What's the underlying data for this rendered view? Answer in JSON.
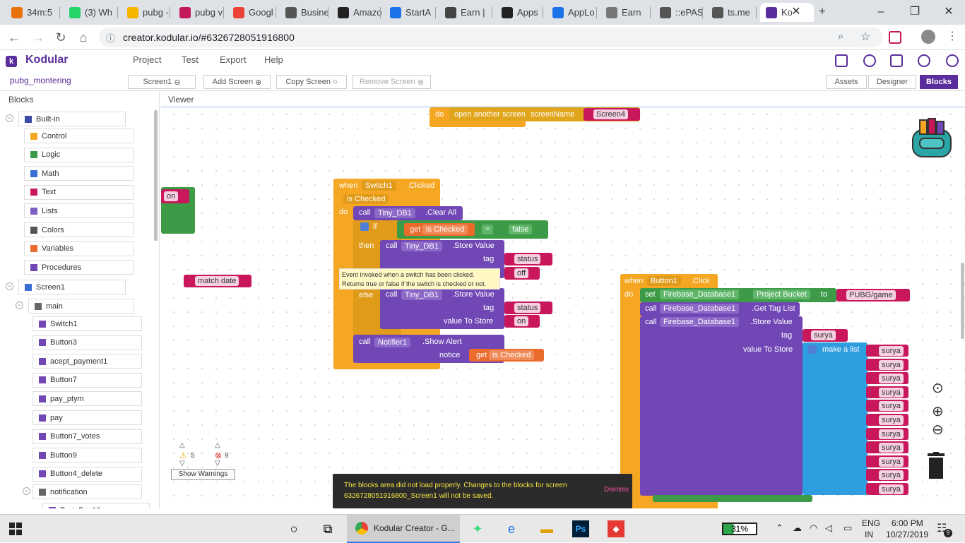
{
  "browser": {
    "tabs": [
      {
        "title": "34m:5",
        "icon": "clock-icon",
        "color": "#e8710a"
      },
      {
        "title": "(3) Wh",
        "icon": "whatsapp-icon",
        "color": "#25d366"
      },
      {
        "title": "pubg -",
        "icon": "folder-icon",
        "color": "#f4b400"
      },
      {
        "title": "pubg v",
        "icon": "pu-icon",
        "color": "#c2185b"
      },
      {
        "title": "Googl",
        "icon": "google-icon",
        "color": "#ea4335"
      },
      {
        "title": "Busine",
        "icon": "page-icon",
        "color": "#555555"
      },
      {
        "title": "Amazo",
        "icon": "amazon-icon",
        "color": "#222222"
      },
      {
        "title": "StartA",
        "icon": "startapp-icon",
        "color": "#1a73e8"
      },
      {
        "title": "Earn |",
        "icon": "earn-icon",
        "color": "#444444"
      },
      {
        "title": "Apps",
        "icon": "apps-icon",
        "color": "#222222"
      },
      {
        "title": "AppLo",
        "icon": "applovin-icon",
        "color": "#1a73e8"
      },
      {
        "title": "Earn",
        "icon": "feather-icon",
        "color": "#777777"
      },
      {
        "title": "::ePAS",
        "icon": "globe-icon",
        "color": "#555555"
      },
      {
        "title": "ts.me",
        "icon": "globe-icon",
        "color": "#555555"
      },
      {
        "title": "Ko",
        "icon": "kodular-icon",
        "color": "#5a2d9c"
      }
    ],
    "url": "creator.kodular.io/#6326728051916800"
  },
  "app": {
    "brand": "Kodular",
    "menu": [
      "Project",
      "Test",
      "Export",
      "Help"
    ],
    "project_name": "pubg_montering",
    "screen_select": "Screen1",
    "add_screen": "Add Screen",
    "copy_screen": "Copy Screen",
    "remove_screen": "Remove Screen",
    "assets": "Assets",
    "designer": "Designer",
    "blocks": "Blocks",
    "blocks_title": "Blocks",
    "viewer_title": "Viewer"
  },
  "tree": {
    "builtin": "Built-in",
    "builtin_items": [
      "Control",
      "Logic",
      "Math",
      "Text",
      "Lists",
      "Colors",
      "Variables",
      "Procedures"
    ],
    "screen": "Screen1",
    "main": "main",
    "components": [
      "Switch1",
      "Button3",
      "acept_payment1",
      "Button7",
      "pay_ptym",
      "pay",
      "Button7_votes",
      "Button9",
      "Button4_delete"
    ],
    "notification": "notification",
    "cut_item": "Text_Box10"
  },
  "blocks": {
    "do": "do",
    "open_another_screen": "open another screen",
    "screen_name": "screenName",
    "screen4": "Screen4",
    "on_chip": "on",
    "match_date": "match date",
    "when": "when",
    "switch1": "Switch1",
    "clicked": ".Clicked",
    "is_checked": "is Checked",
    "call": "call",
    "tiny_db1": "Tiny_DB1",
    "clear_all": ".Clear All",
    "if": "if",
    "get": "get",
    "eq": "=",
    "false": "false",
    "then": "then",
    "store_value": ".Store Value",
    "tag": "tag",
    "status": "status",
    "off": "off",
    "else": "else",
    "value_to_store": "value To Store",
    "on": "on",
    "notifier1": "Notifier1",
    "show_alert": ".Show Alert",
    "notice": "notice",
    "tooltip": "Event invoked when a switch has been clicked. Returns true or false if the switch is checked or not.",
    "button1": "Button1",
    "click": ".Click",
    "set": "set",
    "firebase": "Firebase_Database1",
    "project_bucket": "Project Bucket",
    "to": "to",
    "pubg_game": "PUBG/game",
    "get_tag_list": ".Get Tag List",
    "surya": "surya",
    "make_a_list": "make a list",
    "surya_list": [
      "surya",
      "surya",
      "surya",
      "surya",
      "surya",
      "surya",
      "surya",
      "surya",
      "surya",
      "surya",
      "surya"
    ]
  },
  "warnings": {
    "warn_count": "5",
    "error_count": "9",
    "show_warnings": "Show Warnings"
  },
  "toast": {
    "message": "The blocks area did not load properly. Changes to the blocks for screen 6326728051916800_Screen1 will not be saved.",
    "dismiss": "Dismiss"
  },
  "taskbar": {
    "chrome_title": "Kodular Creator - G...",
    "battery": "31%",
    "lang": "ENG",
    "region": "IN",
    "time": "6:00 PM",
    "date": "10/27/2019",
    "notif_count": "9"
  }
}
